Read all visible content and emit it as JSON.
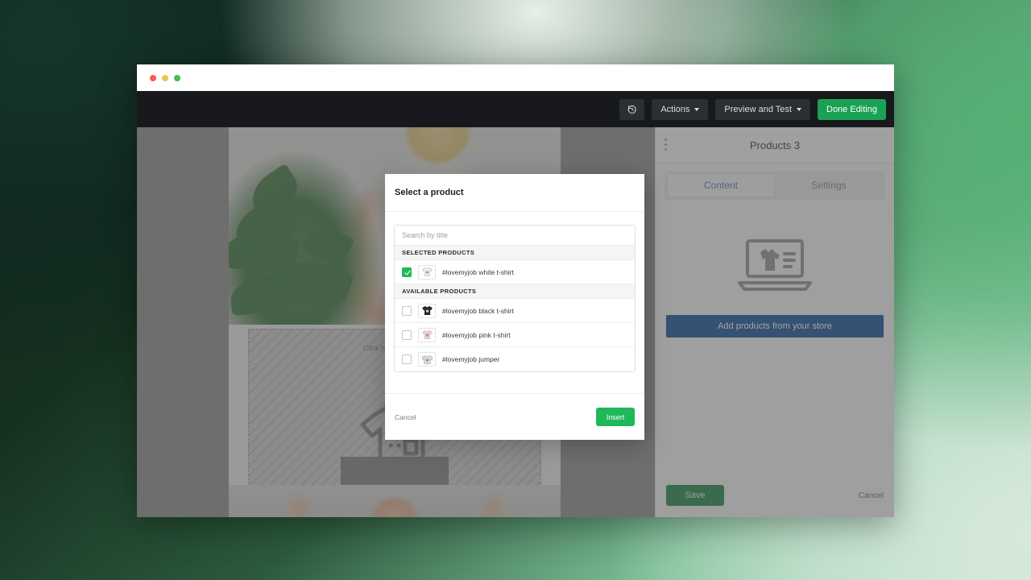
{
  "window": {
    "traffic_lights": [
      "close",
      "minimize",
      "maximize"
    ]
  },
  "toolbar": {
    "history_icon": "undo-history-icon",
    "actions_label": "Actions",
    "preview_label": "Preview and Test",
    "done_label": "Done Editing"
  },
  "canvas": {
    "dropzone_label": "Click here to grab a",
    "dropzone_icon": "tshirt-on-hanger-icon",
    "photo_top_alt": "woman-in-white-tshirt-with-plant",
    "photo_bottom_alt": "bearded-man-holding-rope"
  },
  "side_panel": {
    "kebab_icon": "more-options-icon",
    "title": "Products 3",
    "tabs": [
      {
        "label": "Content",
        "active": true
      },
      {
        "label": "Settings",
        "active": false
      }
    ],
    "empty_illustration_icon": "laptop-with-tshirt-icon",
    "cta_label": "Add products from your store",
    "save_label": "Save",
    "cancel_label": "Cancel"
  },
  "modal": {
    "title": "Select a product",
    "search_placeholder": "Search by title",
    "search_value": "",
    "groups": [
      {
        "heading": "SELECTED PRODUCTS",
        "items": [
          {
            "name": "#lovemyjob white t-shirt",
            "checked": true,
            "color": "#efefef"
          }
        ]
      },
      {
        "heading": "AVAILABLE PRODUCTS",
        "items": [
          {
            "name": "#lovemyjob black t-shirt",
            "checked": false,
            "color": "#2b2b2b"
          },
          {
            "name": "#lovemyjob pink t-shirt",
            "checked": false,
            "color": "#eccfd9"
          },
          {
            "name": "#lovemyjob jumper",
            "checked": false,
            "color": "#d7d7d7"
          }
        ]
      }
    ],
    "cancel_label": "Cancel",
    "insert_label": "Insert"
  },
  "colors": {
    "accent_green": "#1fb85a",
    "done_green": "#1ba154",
    "save_green": "#158040",
    "cta_blue": "#0a4896",
    "tab_active_text": "#4a72c4",
    "toolbar_dark": "#17191c"
  }
}
